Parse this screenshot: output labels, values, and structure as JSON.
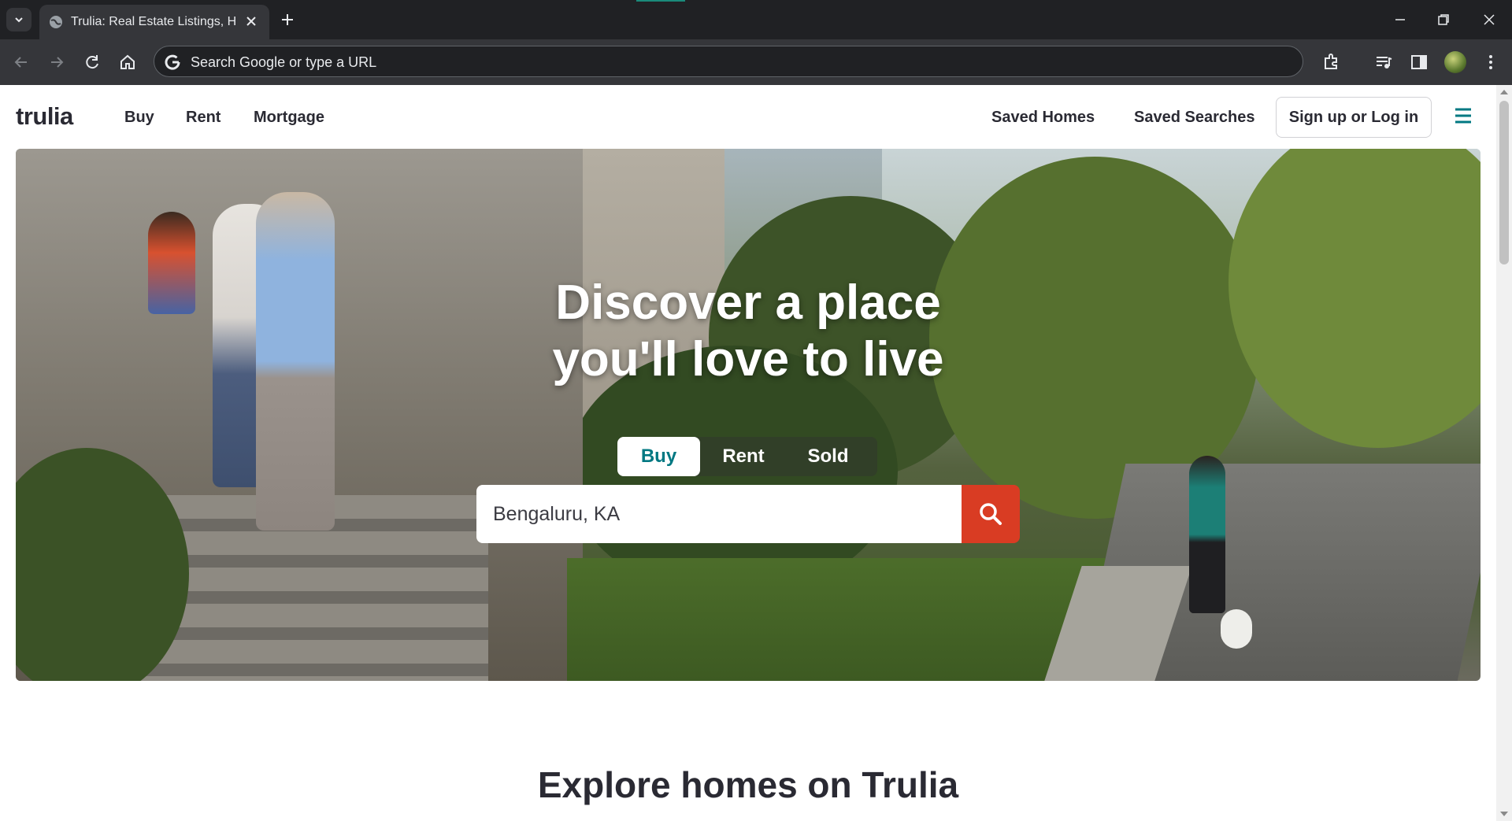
{
  "browser": {
    "tab_title": "Trulia: Real Estate Listings, Homes For Sale, Housing Data",
    "omnibox_placeholder": "Search Google or type a URL"
  },
  "header": {
    "logo": "trulia",
    "nav": [
      "Buy",
      "Rent",
      "Mortgage"
    ],
    "saved_homes": "Saved Homes",
    "saved_searches": "Saved Searches",
    "signup": "Sign up or Log in"
  },
  "hero": {
    "title_line1": "Discover a place",
    "title_line2": "you'll love to live",
    "tabs": [
      "Buy",
      "Rent",
      "Sold"
    ],
    "active_tab": "Buy",
    "search_value": "Bengaluru, KA"
  },
  "section": {
    "explore_title": "Explore homes on Trulia"
  },
  "colors": {
    "brand_teal": "#007882",
    "search_red": "#d93c23",
    "text_dark": "#2a2a33"
  }
}
